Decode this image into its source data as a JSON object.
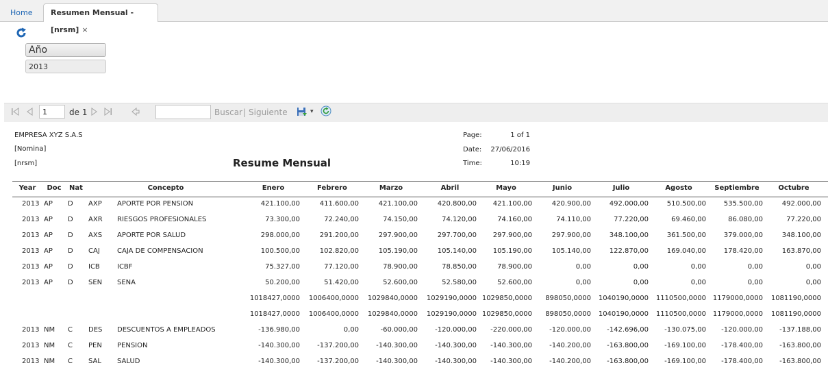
{
  "tabs": {
    "home": "Home",
    "active": "Resumen Mensual -[nrsm]",
    "close": "×"
  },
  "param": {
    "label": "Año",
    "value": "2013"
  },
  "toolbar": {
    "page_value": "1",
    "page_of": "de 1",
    "search": "Buscar",
    "separator": "|",
    "next": "Siguiente",
    "dropdown": "▾"
  },
  "report": {
    "company": "EMPRESA XYZ S.A.S",
    "nomina": "[Nomina]",
    "code": "[nrsm]",
    "title": "Resume Mensual",
    "page_label": "Page:",
    "page_value": "1 of 1",
    "date_label": "Date:",
    "date_value": "27/06/2016",
    "time_label": "Time:",
    "time_value": "10:19"
  },
  "table": {
    "headers": [
      "Year",
      "Doc",
      "Nat",
      "Concepto",
      "Enero",
      "Febrero",
      "Marzo",
      "Abril",
      "Mayo",
      "Junio",
      "Julio",
      "Agosto",
      "Septiembre",
      "Octubre"
    ],
    "rows": [
      [
        "2013",
        "AP",
        "D",
        "AXP",
        "APORTE POR PENSION",
        "421.100,00",
        "411.600,00",
        "421.100,00",
        "420.800,00",
        "421.100,00",
        "420.900,00",
        "492.000,00",
        "510.500,00",
        "535.500,00",
        "492.000,00"
      ],
      [
        "2013",
        "AP",
        "D",
        "AXR",
        "RIESGOS PROFESIONALES",
        "73.300,00",
        "72.240,00",
        "74.150,00",
        "74.120,00",
        "74.160,00",
        "74.110,00",
        "77.220,00",
        "69.460,00",
        "86.080,00",
        "77.220,00"
      ],
      [
        "2013",
        "AP",
        "D",
        "AXS",
        "APORTE POR SALUD",
        "298.000,00",
        "291.200,00",
        "297.900,00",
        "297.700,00",
        "297.900,00",
        "297.900,00",
        "348.100,00",
        "361.500,00",
        "379.000,00",
        "348.100,00"
      ],
      [
        "2013",
        "AP",
        "D",
        "CAJ",
        "CAJA DE COMPENSACION",
        "100.500,00",
        "102.820,00",
        "105.190,00",
        "105.140,00",
        "105.190,00",
        "105.140,00",
        "122.870,00",
        "169.040,00",
        "178.420,00",
        "163.870,00"
      ],
      [
        "2013",
        "AP",
        "D",
        "ICB",
        "ICBF",
        "75.327,00",
        "77.120,00",
        "78.900,00",
        "78.850,00",
        "78.900,00",
        "0,00",
        "0,00",
        "0,00",
        "0,00",
        "0,00"
      ],
      [
        "2013",
        "AP",
        "D",
        "SEN",
        "SENA",
        "50.200,00",
        "51.420,00",
        "52.600,00",
        "52.580,00",
        "52.600,00",
        "0,00",
        "0,00",
        "0,00",
        "0,00",
        "0,00"
      ],
      [
        "",
        "",
        "",
        "",
        "",
        "1018427,0000",
        "1006400,0000",
        "1029840,0000",
        "1029190,0000",
        "1029850,0000",
        "898050,0000",
        "1040190,0000",
        "1110500,0000",
        "1179000,0000",
        "1081190,0000"
      ],
      [
        "",
        "",
        "",
        "",
        "",
        "1018427,0000",
        "1006400,0000",
        "1029840,0000",
        "1029190,0000",
        "1029850,0000",
        "898050,0000",
        "1040190,0000",
        "1110500,0000",
        "1179000,0000",
        "1081190,0000"
      ],
      [
        "2013",
        "NM",
        "C",
        "DES",
        "DESCUENTOS A EMPLEADOS",
        "-136.980,00",
        "0,00",
        "-60.000,00",
        "-120.000,00",
        "-220.000,00",
        "-120.000,00",
        "-142.696,00",
        "-130.075,00",
        "-120.000,00",
        "-137.188,00"
      ],
      [
        "2013",
        "NM",
        "C",
        "PEN",
        "PENSION",
        "-140.300,00",
        "-137.200,00",
        "-140.300,00",
        "-140.300,00",
        "-140.300,00",
        "-140.200,00",
        "-163.800,00",
        "-169.100,00",
        "-178.400,00",
        "-163.800,00"
      ],
      [
        "2013",
        "NM",
        "C",
        "SAL",
        "SALUD",
        "-140.300,00",
        "-137.200,00",
        "-140.300,00",
        "-140.300,00",
        "-140.300,00",
        "-140.200,00",
        "-163.800,00",
        "-169.100,00",
        "-178.400,00",
        "-163.800,00"
      ]
    ]
  },
  "colors": {
    "accent": "#1f66b4",
    "toolbar_bg": "#eeeeee",
    "tab_bg": "#f1f1f1"
  },
  "icons": [
    "refresh-icon",
    "first-page-icon",
    "prev-page-icon",
    "next-page-icon",
    "last-page-icon",
    "back-icon",
    "export-icon",
    "dropdown-icon",
    "report-refresh-icon"
  ]
}
